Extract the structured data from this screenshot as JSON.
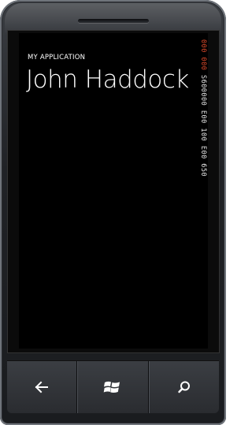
{
  "app": {
    "application_title": "MY APPLICATION",
    "page_title": "John Haddock"
  },
  "side_column": {
    "accent_text": "000 000",
    "normal_text": "S600000 E00 100 E00 650",
    "accent_color": "#e04b2b",
    "text_color": "#e8e8e8"
  },
  "hardware_buttons": [
    {
      "name": "back-button",
      "icon": "back-arrow-icon"
    },
    {
      "name": "start-button",
      "icon": "windows-logo-icon"
    },
    {
      "name": "search-button",
      "icon": "search-icon"
    }
  ]
}
